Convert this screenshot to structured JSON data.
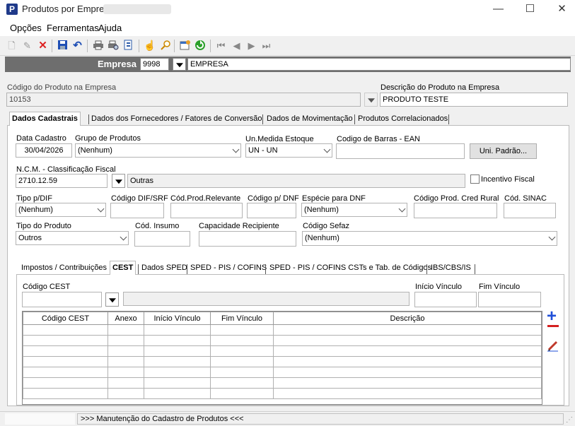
{
  "window": {
    "title": "Produtos por Empresa",
    "min": "—",
    "max": "☐",
    "close": "✕"
  },
  "menu": [
    "Opções",
    "Ferramentas",
    "Ajuda"
  ],
  "toolbar": {
    "icons": [
      "new-icon",
      "edit-icon",
      "delete-icon",
      "save-icon",
      "undo-icon",
      "print-icon",
      "print-preview-icon",
      "export-icon",
      "import-icon",
      "search-icon",
      "settings-icon",
      "refresh-icon",
      "first-icon",
      "prev-icon",
      "next-icon",
      "last-icon"
    ]
  },
  "empresa": {
    "label": "Empresa",
    "code": "9998",
    "name": "EMPRESA"
  },
  "header": {
    "codigo_label": "Código do Produto na Empresa",
    "codigo_value": "10153",
    "descricao_label": "Descrição do Produto na Empresa",
    "descricao_value": "PRODUTO TESTE"
  },
  "main_tabs": [
    "Dados Cadastrais",
    "Dados dos Fornecedores / Fatores de Conversão",
    "Dados de Movimentação",
    "Produtos Correlacionados"
  ],
  "cadastro": {
    "data_label": "Data Cadastro",
    "data_value": "30/04/2026",
    "grupo_label": "Grupo de Produtos",
    "grupo_value": "(Nenhum)",
    "unidade_label": "Un.Medida Estoque",
    "unidade_value": "UN - UN",
    "ean_label": "Codigo de Barras - EAN",
    "ean_value": "",
    "uni_padrao_btn": "Uni. Padrão...",
    "ncm_label": "N.C.M. - Classificação Fiscal",
    "ncm_value": "2710.12.59",
    "ncm_desc": "Outras",
    "incentivo_label": "Incentivo Fiscal",
    "tipo_dif_label": "Tipo p/DIF",
    "tipo_dif_value": "(Nenhum)",
    "cod_dif_label": "Código DIF/SRF",
    "cod_relev_label": "Cód.Prod.Relevante",
    "cod_dnf_label": "Código p/ DNF",
    "especie_label": "Espécie para DNF",
    "especie_value": "(Nenhum)",
    "cod_rural_label": "Código Prod. Cred Rural",
    "sinac_label": "Cód. SINAC",
    "tipo_prod_label": "Tipo do Produto",
    "tipo_prod_value": "Outros",
    "insumo_label": "Cód. Insumo",
    "capacidade_label": "Capacidade Recipiente",
    "sefaz_label": "Código Sefaz",
    "sefaz_value": "(Nenhum)"
  },
  "sub_tabs": [
    "Impostos / Contribuições",
    "CEST",
    "Dados SPED",
    "SPED - PIS / COFINS",
    "SPED - PIS / COFINS CSTs e Tab. de Códigos",
    "IBS/CBS/IS"
  ],
  "cest": {
    "codigo_label": "Código CEST",
    "inicio_label": "Início Vínculo",
    "fim_label": "Fim Vínculo",
    "columns": [
      "Código CEST",
      "Anexo",
      "Início Vínculo",
      "Fim Vínculo",
      "Descrição"
    ]
  },
  "side_actions": {
    "add": "+",
    "remove": "−"
  },
  "status": {
    "text": ">>> Manutenção do Cadastro de Produtos <<<"
  }
}
